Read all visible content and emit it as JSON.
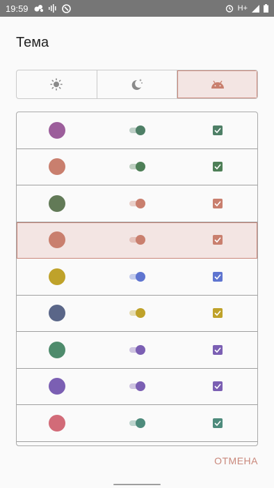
{
  "status": {
    "time": "19:59",
    "network": "H+"
  },
  "dialog": {
    "title": "Тема",
    "cancel_label": "ОТМЕНА"
  },
  "theme_modes": [
    {
      "icon": "sun-icon",
      "selected": false
    },
    {
      "icon": "moon-stars-icon",
      "selected": false
    },
    {
      "icon": "android-icon",
      "selected": true
    }
  ],
  "palettes": [
    {
      "primary": "#9c5e9b",
      "accent": "#4e7f66",
      "selected": false
    },
    {
      "primary": "#c97f6e",
      "accent": "#4e7f57",
      "selected": false
    },
    {
      "primary": "#627a57",
      "accent": "#c97f6e",
      "selected": false
    },
    {
      "primary": "#c97f6e",
      "accent": "#c97f6e",
      "selected": true
    },
    {
      "primary": "#bfa22a",
      "accent": "#5f75d0",
      "selected": false
    },
    {
      "primary": "#5a6688",
      "accent": "#bfa22a",
      "selected": false
    },
    {
      "primary": "#4e8b6c",
      "accent": "#7b5fb3",
      "selected": false
    },
    {
      "primary": "#7b5fb3",
      "accent": "#7b5fb3",
      "selected": false
    },
    {
      "primary": "#d26b78",
      "accent": "#4e8b7c",
      "selected": false
    }
  ]
}
